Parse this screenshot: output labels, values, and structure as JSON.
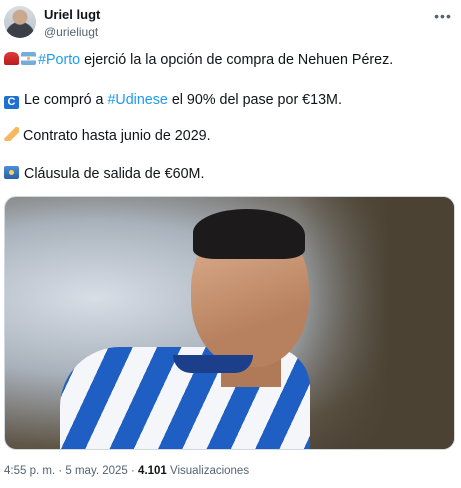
{
  "author": {
    "display_name": "Uriel lugt",
    "handle": "@urieliugt"
  },
  "menu_icon": "more-horizontal-icon",
  "tweet": {
    "line1_pre": "",
    "line1_hashtag": "#Porto",
    "line1_post": " ejerció la la opción de compra de Nehuen Pérez.",
    "line2_pre": "Le compró a ",
    "line2_hashtag": "#Udinese",
    "line2_post": " el 90% del pase por €13M.",
    "line3": "Contrato hasta junio de 2029.",
    "line4": "Cláusula de salida de €60M."
  },
  "emojis": [
    "police-light-emoji",
    "argentina-flag-emoji",
    "c-symbol-emoji",
    "writing-hand-emoji",
    "vault-emoji"
  ],
  "meta": {
    "time": "4:55 p. m.",
    "sep": " · ",
    "date": "5 may. 2025",
    "sep2": " · ",
    "views": "4.101",
    "views_label": " Visualizaciones"
  }
}
